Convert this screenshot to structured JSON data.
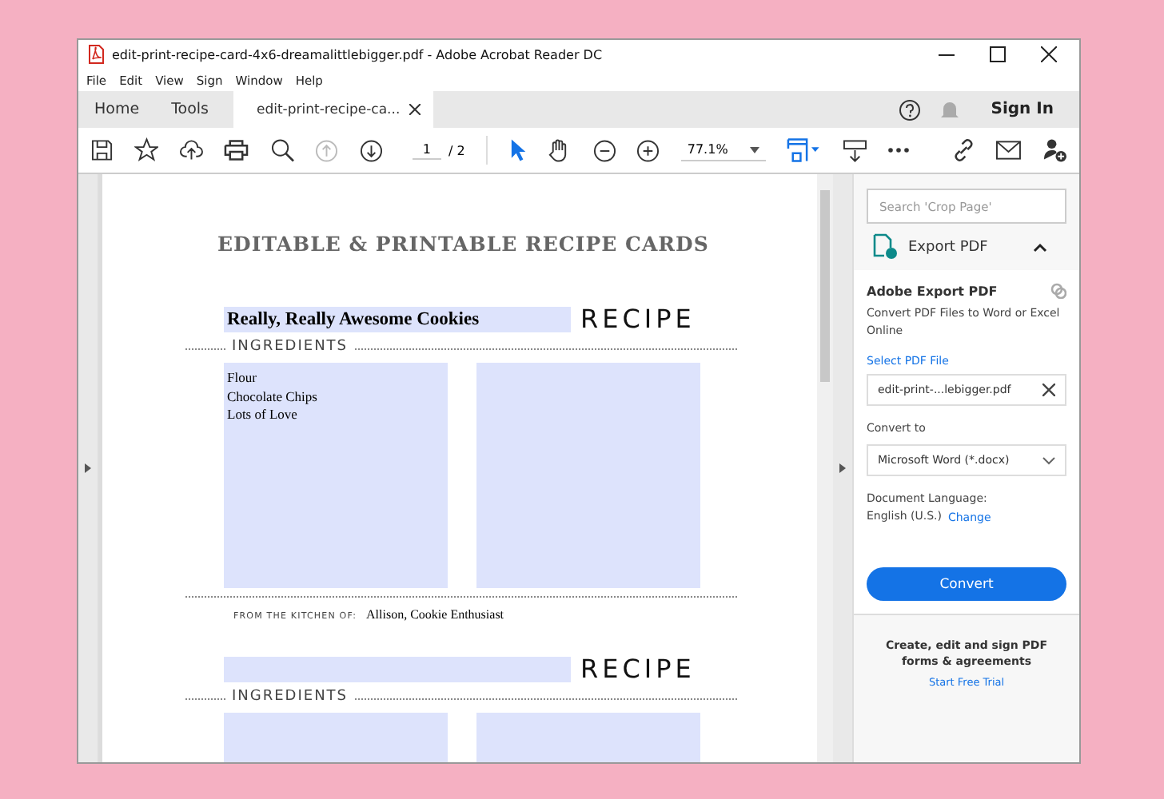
{
  "window": {
    "title": "edit-print-recipe-card-4x6-dreamalittlebigger.pdf - Adobe Acrobat Reader DC"
  },
  "menu": [
    "File",
    "Edit",
    "View",
    "Sign",
    "Window",
    "Help"
  ],
  "tabs": [
    {
      "label": "Home",
      "selected": false,
      "closable": false
    },
    {
      "label": "Tools",
      "selected": false,
      "closable": false
    },
    {
      "label": "edit-print-recipe-ca...",
      "selected": true,
      "closable": true
    }
  ],
  "sign_in": "Sign In",
  "toolbar": {
    "page": "1",
    "page_total": "/ 2",
    "zoom": "77.1%"
  },
  "document": {
    "heading": "EDITABLE & PRINTABLE RECIPE CARDS",
    "cards": [
      {
        "recipe_label": "RECIPE",
        "title": "Really, Really Awesome Cookies",
        "ingredients_label": "INGREDIENTS",
        "ingredients": [
          "Flour",
          "Chocolate Chips",
          "Lots of Love"
        ],
        "from_label": "FROM THE KITCHEN OF:",
        "from_value": "Allison, Cookie Enthusiast"
      },
      {
        "recipe_label": "RECIPE",
        "ingredients_label": "INGREDIENTS"
      }
    ]
  },
  "panel": {
    "search_placeholder": "Search 'Crop Page'",
    "tool": "Export PDF",
    "section_title": "Adobe Export PDF",
    "description": "Convert PDF Files to Word or Excel Online",
    "select_label": "Select PDF File",
    "file": "edit-print-...lebigger.pdf",
    "convert_to_label": "Convert to",
    "convert_to": "Microsoft Word (*.docx)",
    "language_label": "Document Language:",
    "language": "English (U.S.)",
    "change": "Change",
    "convert_button": "Convert",
    "promo": "Create, edit and sign PDF forms & agreements",
    "trial": "Start Free Trial"
  }
}
